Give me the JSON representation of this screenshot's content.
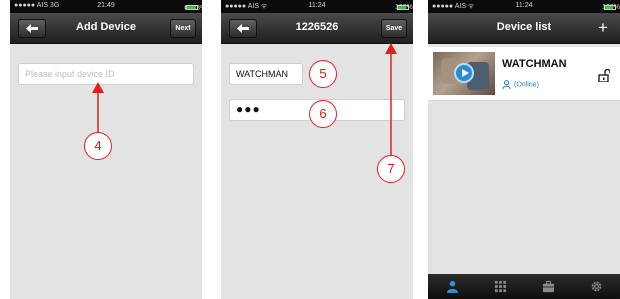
{
  "screens": [
    {
      "status": {
        "left": "●●●●● AIS  3G",
        "time": "21:49",
        "right": "⚉ 83%"
      },
      "title": "Add Device",
      "right_button": "Next",
      "device_id_placeholder": "Please input device ID",
      "callout": "4"
    },
    {
      "status": {
        "left": "●●●●● AIS ᯤ",
        "time": "11:24",
        "right": "100%"
      },
      "title": "1226526",
      "right_button": "Save",
      "name_value": "WATCHMAN",
      "password_value": "●●●",
      "callouts": [
        "5",
        "6",
        "7"
      ]
    },
    {
      "status": {
        "left": "●●●●● AIS ᯤ",
        "time": "11:24",
        "right": "100%"
      },
      "title": "Device list",
      "add_label": "+",
      "device": {
        "name": "WATCHMAN",
        "status": "(Online)"
      },
      "tabs": [
        "user-icon",
        "grid-icon",
        "toolbox-icon",
        "gear-icon"
      ]
    }
  ],
  "colors": {
    "callout": "#e02020",
    "online": "#2b84c7",
    "active_tab": "#2d8fd6"
  }
}
